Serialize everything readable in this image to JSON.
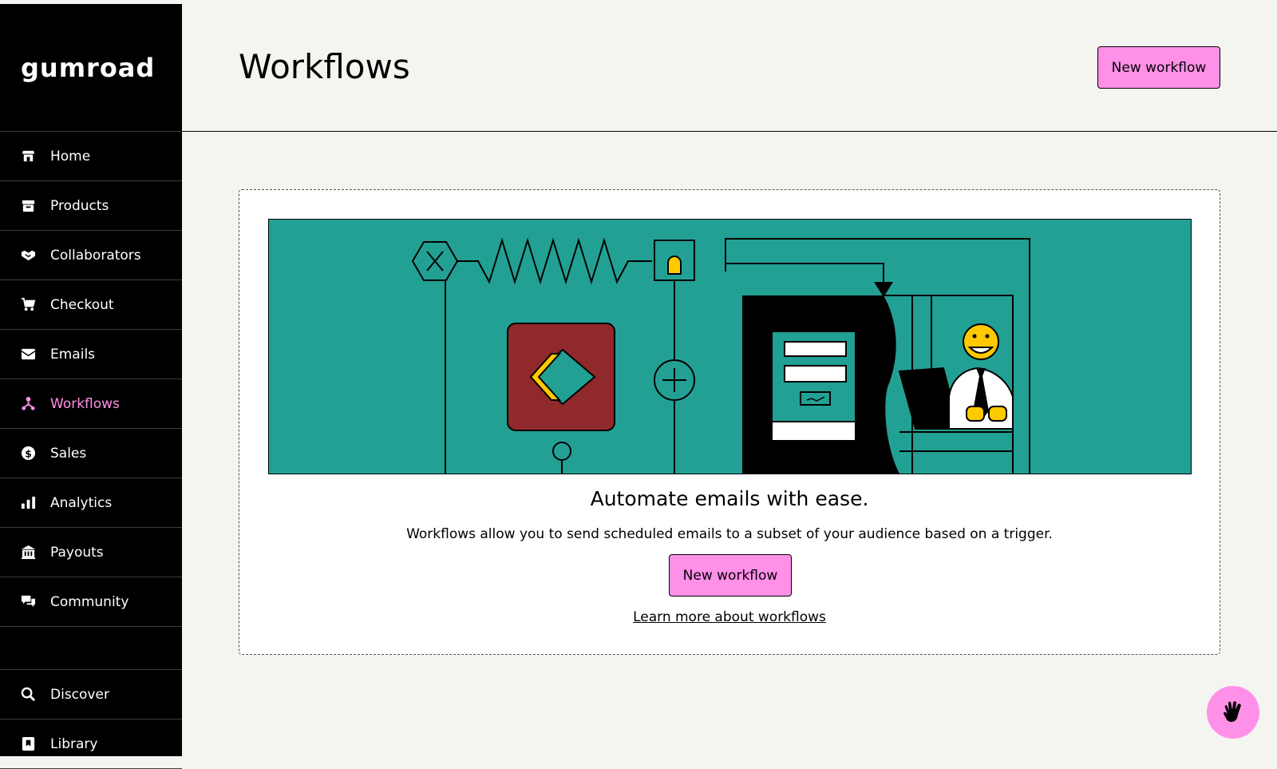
{
  "brand": {
    "logo_text": "gumroad"
  },
  "sidebar": {
    "items": [
      {
        "label": "Home",
        "icon": "store-icon",
        "active": false
      },
      {
        "label": "Products",
        "icon": "archive-icon",
        "active": false
      },
      {
        "label": "Collaborators",
        "icon": "handshake-icon",
        "active": false
      },
      {
        "label": "Checkout",
        "icon": "cart-icon",
        "active": false
      },
      {
        "label": "Emails",
        "icon": "envelope-icon",
        "active": false
      },
      {
        "label": "Workflows",
        "icon": "workflow-icon",
        "active": true
      },
      {
        "label": "Sales",
        "icon": "dollar-circle-icon",
        "active": false
      },
      {
        "label": "Analytics",
        "icon": "bar-chart-icon",
        "active": false
      },
      {
        "label": "Payouts",
        "icon": "bank-icon",
        "active": false
      },
      {
        "label": "Community",
        "icon": "chat-icon",
        "active": false
      }
    ],
    "bottom_items": [
      {
        "label": "Discover",
        "icon": "search-icon"
      },
      {
        "label": "Library",
        "icon": "bookmark-icon"
      }
    ]
  },
  "header": {
    "title": "Workflows",
    "new_workflow_label": "New workflow"
  },
  "empty_state": {
    "title": "Automate emails with ease.",
    "description": "Workflows allow you to send scheduled emails to a subset of your audience based on a trigger.",
    "button_label": "New workflow",
    "learn_more_link": "Learn more about workflows"
  },
  "colors": {
    "accent_pink": "#ff90e8",
    "sidebar_bg": "#000000",
    "page_bg": "#f4f4f0",
    "illustration_teal": "#23a094",
    "illustration_red": "#90292b",
    "illustration_yellow": "#ffc900"
  },
  "help": {
    "icon": "hand-wave-icon"
  }
}
